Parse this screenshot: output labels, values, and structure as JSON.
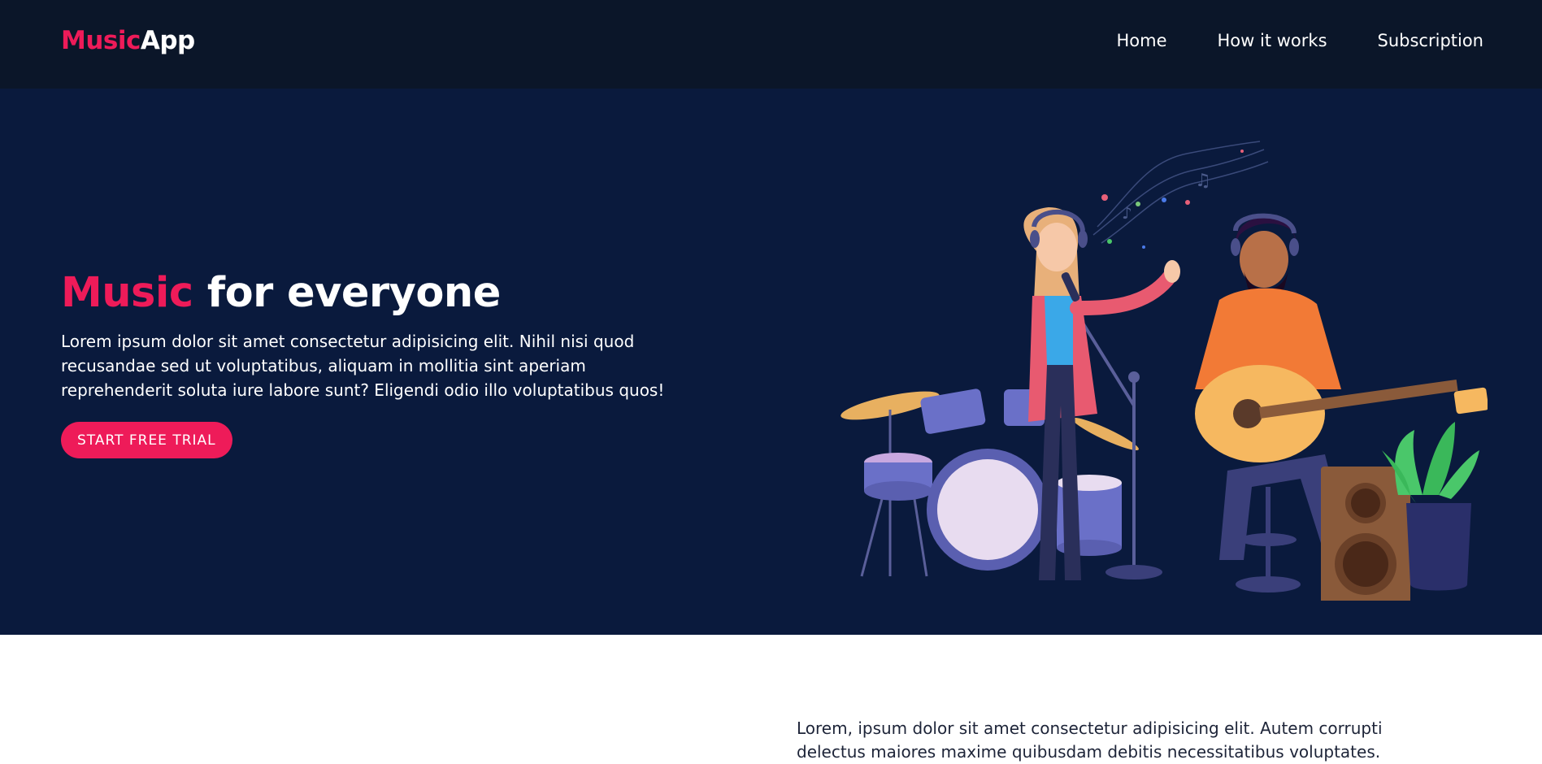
{
  "navbar": {
    "brand_accent": "Music",
    "brand_rest": "App",
    "links": [
      "Home",
      "How it works",
      "Subscription"
    ]
  },
  "hero": {
    "title_accent": "Music",
    "title_rest": " for everyone",
    "text": "Lorem ipsum dolor sit amet consectetur adipisicing elit. Nihil nisi quod recusandae sed ut voluptatibus, aliquam in mollitia sint aperiam reprehenderit soluta iure labore sunt? Eligendi odio illo voluptatibus quos!",
    "cta_label": "START FREE TRIAL"
  },
  "content": {
    "text": "Lorem, ipsum dolor sit amet consectetur adipisicing elit. Autem corrupti delectus maiores maxime quibusdam debitis necessitatibus voluptates."
  },
  "colors": {
    "accent": "#ee1b59",
    "navbar_bg": "#0b1629",
    "hero_bg": "#0a1a3d"
  }
}
